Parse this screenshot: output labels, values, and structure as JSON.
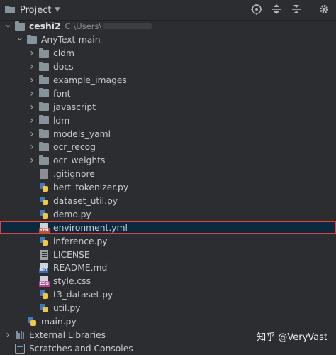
{
  "header": {
    "title": "Project",
    "tools": [
      "crosshair-icon",
      "expand-all-icon",
      "collapse-all-icon",
      "settings-icon"
    ]
  },
  "tree": [
    {
      "name": "root-ceshi2",
      "label": "ceshi2",
      "path": "C:\\Users\\",
      "bold": true,
      "indent": 0,
      "type": "folder",
      "arrow": "open"
    },
    {
      "name": "anytext-main",
      "label": "AnyText-main",
      "indent": 1,
      "type": "folder",
      "arrow": "open"
    },
    {
      "name": "folder-cldm",
      "label": "cldm",
      "indent": 2,
      "type": "folder",
      "arrow": "closed"
    },
    {
      "name": "folder-docs",
      "label": "docs",
      "indent": 2,
      "type": "folder",
      "arrow": "closed"
    },
    {
      "name": "folder-example-images",
      "label": "example_images",
      "indent": 2,
      "type": "folder",
      "arrow": "closed"
    },
    {
      "name": "folder-font",
      "label": "font",
      "indent": 2,
      "type": "folder",
      "arrow": "closed"
    },
    {
      "name": "folder-javascript",
      "label": "javascript",
      "indent": 2,
      "type": "folder",
      "arrow": "closed"
    },
    {
      "name": "folder-ldm",
      "label": "ldm",
      "indent": 2,
      "type": "folder",
      "arrow": "closed"
    },
    {
      "name": "folder-models-yaml",
      "label": "models_yaml",
      "indent": 2,
      "type": "folder",
      "arrow": "closed"
    },
    {
      "name": "folder-ocr-recog",
      "label": "ocr_recog",
      "indent": 2,
      "type": "folder",
      "arrow": "closed"
    },
    {
      "name": "folder-ocr-weights",
      "label": "ocr_weights",
      "indent": 2,
      "type": "folder",
      "arrow": "closed"
    },
    {
      "name": "file-gitignore",
      "label": ".gitignore",
      "indent": 2,
      "type": "git"
    },
    {
      "name": "file-bert-tokenizer",
      "label": "bert_tokenizer.py",
      "indent": 2,
      "type": "py"
    },
    {
      "name": "file-dataset-util",
      "label": "dataset_util.py",
      "indent": 2,
      "type": "py"
    },
    {
      "name": "file-demo",
      "label": "demo.py",
      "indent": 2,
      "type": "py"
    },
    {
      "name": "file-environment-yml",
      "label": "environment.yml",
      "indent": 2,
      "type": "yml",
      "selected": true
    },
    {
      "name": "file-inference",
      "label": "inference.py",
      "indent": 2,
      "type": "py"
    },
    {
      "name": "file-license",
      "label": "LICENSE",
      "indent": 2,
      "type": "license"
    },
    {
      "name": "file-readme",
      "label": "README.md",
      "indent": 2,
      "type": "md"
    },
    {
      "name": "file-style-css",
      "label": "style.css",
      "indent": 2,
      "type": "css"
    },
    {
      "name": "file-t3-dataset",
      "label": "t3_dataset.py",
      "indent": 2,
      "type": "py"
    },
    {
      "name": "file-util",
      "label": "util.py",
      "indent": 2,
      "type": "py"
    },
    {
      "name": "file-main",
      "label": "main.py",
      "indent": 1,
      "type": "py"
    },
    {
      "name": "external-libraries",
      "label": "External Libraries",
      "indent": 0,
      "type": "lib",
      "arrow": "closed"
    },
    {
      "name": "scratches-and-consoles",
      "label": "Scratches and Consoles",
      "indent": 0,
      "type": "scratch",
      "arrow": "none"
    }
  ],
  "file_tags": {
    "yml": "YML",
    "md": "MD",
    "css": "CSS"
  },
  "watermark": "知乎 @VeryVast",
  "colors": {
    "selection": "#0d293e",
    "highlight_border": "#e04040",
    "background": "#2b2d30"
  }
}
